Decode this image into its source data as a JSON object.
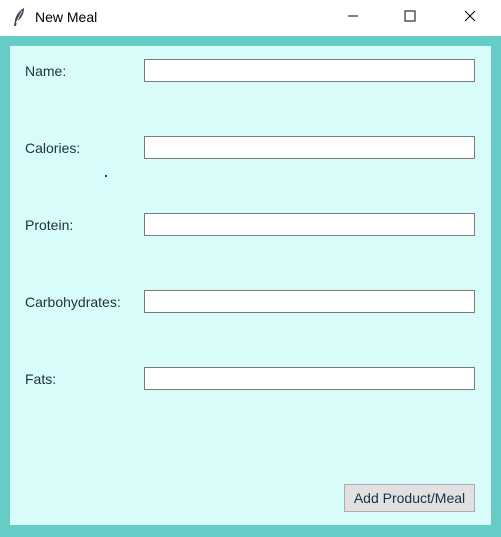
{
  "window": {
    "title": "New Meal",
    "icon": "feather-icon",
    "controls": [
      "minimize-icon",
      "maximize-icon",
      "close-icon"
    ]
  },
  "form": {
    "fields": [
      {
        "label": "Name:",
        "value": ""
      },
      {
        "label": "Calories:",
        "value": ""
      },
      {
        "label": "Protein:",
        "value": ""
      },
      {
        "label": "Carbohydrates:",
        "value": ""
      },
      {
        "label": "Fats:",
        "value": ""
      }
    ],
    "submit_label": "Add Product/Meal"
  },
  "colors": {
    "frame": "#66cdc6",
    "background": "#d8fcfa",
    "label_text": "#1f2f3f",
    "button_face": "#e1e1e1"
  }
}
